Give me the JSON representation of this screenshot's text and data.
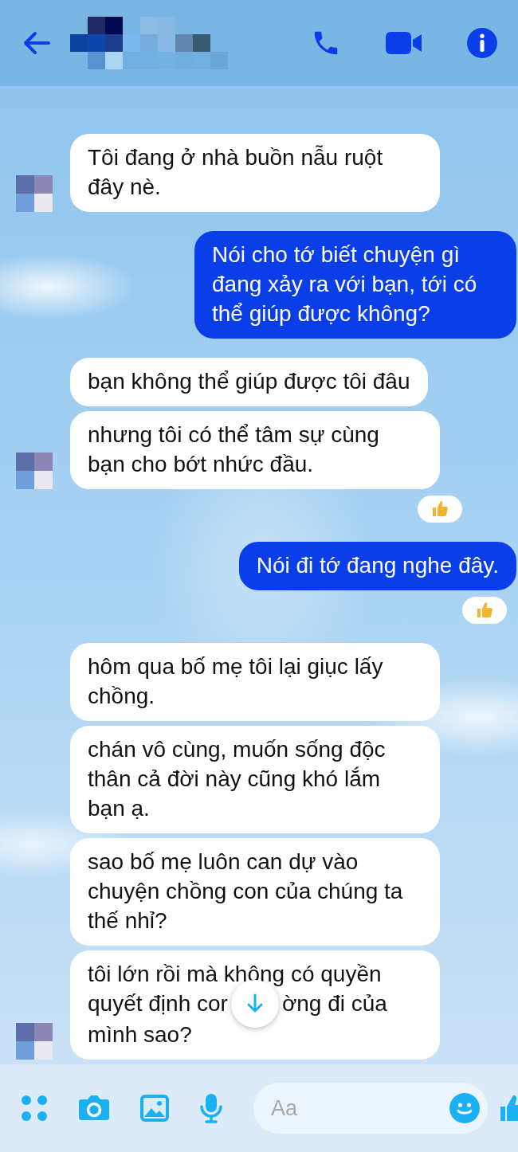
{
  "messages": [
    {
      "kind": "received",
      "text": "Tôi đang ở nhà buồn nẫu ruột đây nè.",
      "avatar": true
    },
    {
      "kind": "sent",
      "text": "Nói cho tớ biết chuyện gì đang xảy ra với bạn, tới có thể giúp được không?"
    },
    {
      "kind": "received",
      "text": "bạn không thể giúp được tôi đâu",
      "avatar": false
    },
    {
      "kind": "received",
      "text": "nhưng tôi có thể tâm sự cùng bạn cho bớt nhức đầu.",
      "avatar": true,
      "liked": true
    },
    {
      "kind": "sent",
      "text": "Nói đi tớ đang nghe đây.",
      "liked": true
    },
    {
      "kind": "received",
      "text": "hôm qua bố mẹ tôi lại giục lấy chồng.",
      "avatar": false
    },
    {
      "kind": "received",
      "text": "chán vô cùng, muốn sống độc thân cả đời này cũng khó lắm bạn ạ.",
      "avatar": false
    },
    {
      "kind": "received",
      "text": "sao bố mẹ luôn can dự vào chuyện chồng con của chúng ta thế nhỉ?",
      "avatar": false
    },
    {
      "kind": "received",
      "parts": [
        "tôi lớn rồi mà không có quyền quyết định cor",
        "ờng đi của mình sao?"
      ],
      "avatar": true
    }
  ],
  "composer": {
    "placeholder": "Aa"
  }
}
